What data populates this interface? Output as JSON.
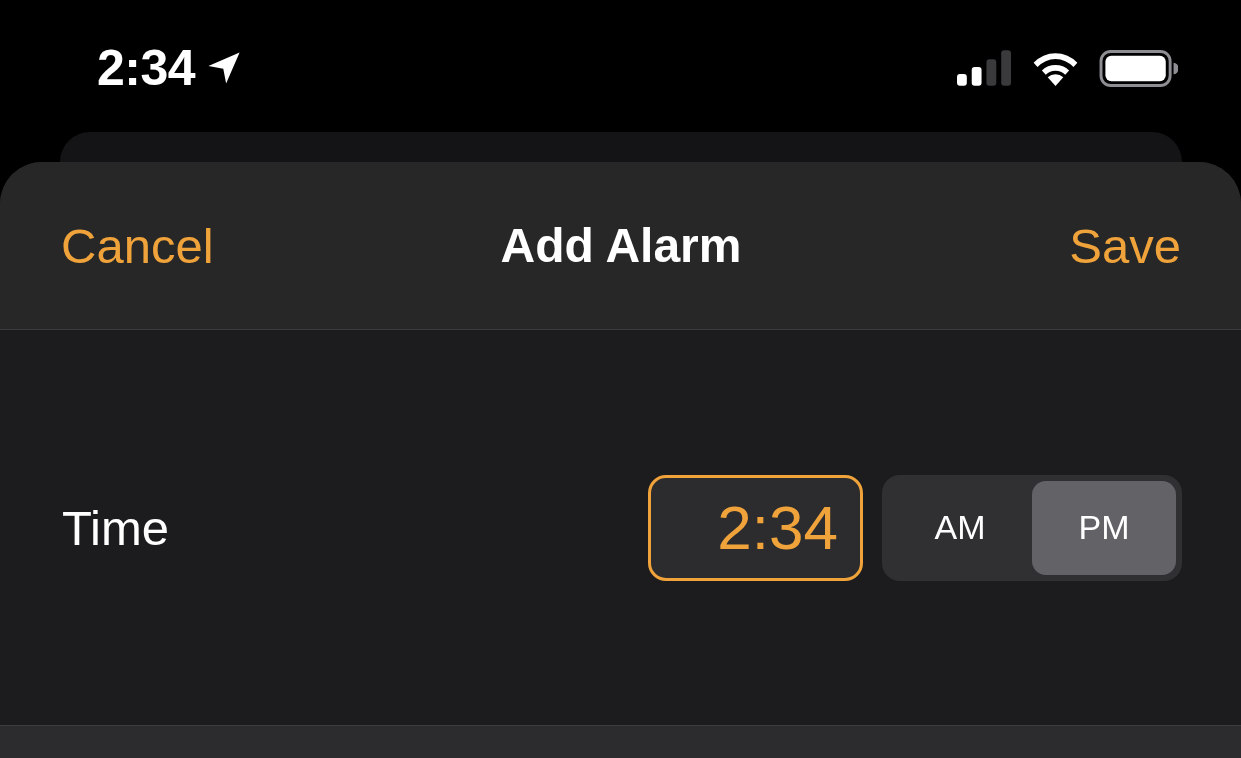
{
  "status_bar": {
    "time": "2:34"
  },
  "nav_bar": {
    "cancel": "Cancel",
    "title": "Add Alarm",
    "save": "Save"
  },
  "time_row": {
    "label": "Time",
    "value": "2:34",
    "editing": true,
    "periods": [
      {
        "label": "AM",
        "selected": false
      },
      {
        "label": "PM",
        "selected": true
      }
    ]
  }
}
